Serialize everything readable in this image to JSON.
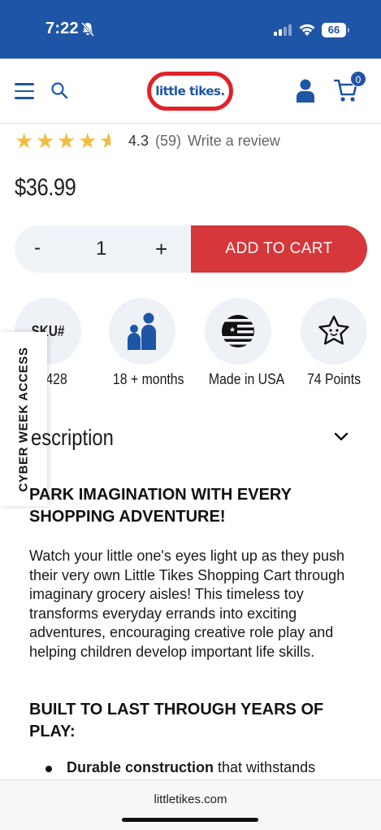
{
  "status_bar": {
    "time": "7:22",
    "battery": "66"
  },
  "header": {
    "logo_text": "little tikes.",
    "cart_count": "0"
  },
  "rating": {
    "value": "4.3",
    "count": "(59)",
    "write_review": "Write a review",
    "stars_filled": 4.3
  },
  "price": "$36.99",
  "purchase": {
    "minus": "-",
    "quantity": "1",
    "plus": "+",
    "add_to_cart": "ADD TO CART"
  },
  "features": [
    {
      "icon": "sku-icon",
      "icon_text": "SKU#",
      "label": "428"
    },
    {
      "icon": "family-icon",
      "label": "18 + months"
    },
    {
      "icon": "flag-icon",
      "label": "Made in USA"
    },
    {
      "icon": "star-face-icon",
      "label": "74 Points"
    }
  ],
  "cyber_tab": "CYBER WEEK ACCESS",
  "description": {
    "title": "escription",
    "heading1": "PARK IMAGINATION WITH EVERY SHOPPING ADVENTURE!",
    "body": "Watch your little one's eyes light up as they push their very own Little Tikes Shopping Cart through imaginary grocery aisles! This timeless toy transforms everyday errands into exciting adventures, encouraging creative role play and helping children develop important life skills.",
    "heading2": "BUILT TO LAST THROUGH YEARS OF PLAY:",
    "bullet_bold": "Durable construction",
    "bullet_rest": " that withstands"
  },
  "browser": {
    "domain": "littletikes.com"
  },
  "colors": {
    "brand_blue": "#1f55a6",
    "cart_red": "#d6373b",
    "star_yellow": "#f3bd3d",
    "logo_red": "#e32028"
  }
}
